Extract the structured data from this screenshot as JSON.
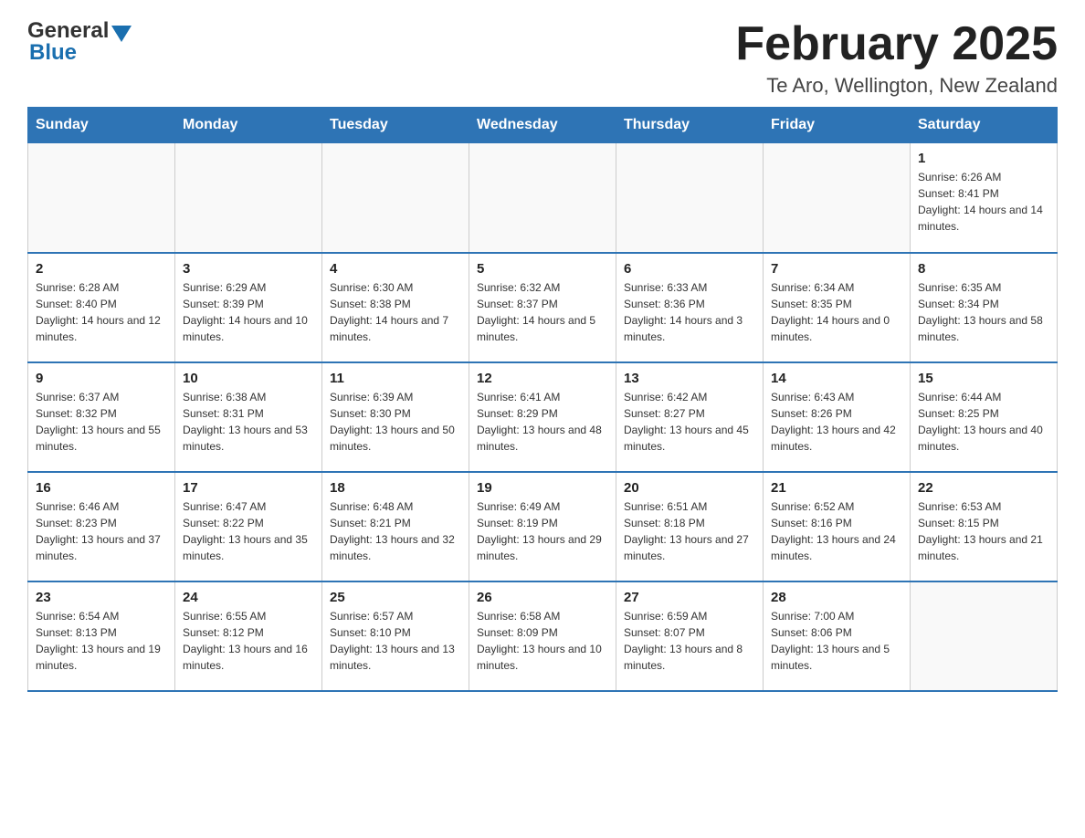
{
  "header": {
    "logo_general": "General",
    "logo_blue": "Blue",
    "month_title": "February 2025",
    "location": "Te Aro, Wellington, New Zealand"
  },
  "days_of_week": [
    "Sunday",
    "Monday",
    "Tuesday",
    "Wednesday",
    "Thursday",
    "Friday",
    "Saturday"
  ],
  "weeks": [
    [
      {
        "day": "",
        "info": ""
      },
      {
        "day": "",
        "info": ""
      },
      {
        "day": "",
        "info": ""
      },
      {
        "day": "",
        "info": ""
      },
      {
        "day": "",
        "info": ""
      },
      {
        "day": "",
        "info": ""
      },
      {
        "day": "1",
        "info": "Sunrise: 6:26 AM\nSunset: 8:41 PM\nDaylight: 14 hours and 14 minutes."
      }
    ],
    [
      {
        "day": "2",
        "info": "Sunrise: 6:28 AM\nSunset: 8:40 PM\nDaylight: 14 hours and 12 minutes."
      },
      {
        "day": "3",
        "info": "Sunrise: 6:29 AM\nSunset: 8:39 PM\nDaylight: 14 hours and 10 minutes."
      },
      {
        "day": "4",
        "info": "Sunrise: 6:30 AM\nSunset: 8:38 PM\nDaylight: 14 hours and 7 minutes."
      },
      {
        "day": "5",
        "info": "Sunrise: 6:32 AM\nSunset: 8:37 PM\nDaylight: 14 hours and 5 minutes."
      },
      {
        "day": "6",
        "info": "Sunrise: 6:33 AM\nSunset: 8:36 PM\nDaylight: 14 hours and 3 minutes."
      },
      {
        "day": "7",
        "info": "Sunrise: 6:34 AM\nSunset: 8:35 PM\nDaylight: 14 hours and 0 minutes."
      },
      {
        "day": "8",
        "info": "Sunrise: 6:35 AM\nSunset: 8:34 PM\nDaylight: 13 hours and 58 minutes."
      }
    ],
    [
      {
        "day": "9",
        "info": "Sunrise: 6:37 AM\nSunset: 8:32 PM\nDaylight: 13 hours and 55 minutes."
      },
      {
        "day": "10",
        "info": "Sunrise: 6:38 AM\nSunset: 8:31 PM\nDaylight: 13 hours and 53 minutes."
      },
      {
        "day": "11",
        "info": "Sunrise: 6:39 AM\nSunset: 8:30 PM\nDaylight: 13 hours and 50 minutes."
      },
      {
        "day": "12",
        "info": "Sunrise: 6:41 AM\nSunset: 8:29 PM\nDaylight: 13 hours and 48 minutes."
      },
      {
        "day": "13",
        "info": "Sunrise: 6:42 AM\nSunset: 8:27 PM\nDaylight: 13 hours and 45 minutes."
      },
      {
        "day": "14",
        "info": "Sunrise: 6:43 AM\nSunset: 8:26 PM\nDaylight: 13 hours and 42 minutes."
      },
      {
        "day": "15",
        "info": "Sunrise: 6:44 AM\nSunset: 8:25 PM\nDaylight: 13 hours and 40 minutes."
      }
    ],
    [
      {
        "day": "16",
        "info": "Sunrise: 6:46 AM\nSunset: 8:23 PM\nDaylight: 13 hours and 37 minutes."
      },
      {
        "day": "17",
        "info": "Sunrise: 6:47 AM\nSunset: 8:22 PM\nDaylight: 13 hours and 35 minutes."
      },
      {
        "day": "18",
        "info": "Sunrise: 6:48 AM\nSunset: 8:21 PM\nDaylight: 13 hours and 32 minutes."
      },
      {
        "day": "19",
        "info": "Sunrise: 6:49 AM\nSunset: 8:19 PM\nDaylight: 13 hours and 29 minutes."
      },
      {
        "day": "20",
        "info": "Sunrise: 6:51 AM\nSunset: 8:18 PM\nDaylight: 13 hours and 27 minutes."
      },
      {
        "day": "21",
        "info": "Sunrise: 6:52 AM\nSunset: 8:16 PM\nDaylight: 13 hours and 24 minutes."
      },
      {
        "day": "22",
        "info": "Sunrise: 6:53 AM\nSunset: 8:15 PM\nDaylight: 13 hours and 21 minutes."
      }
    ],
    [
      {
        "day": "23",
        "info": "Sunrise: 6:54 AM\nSunset: 8:13 PM\nDaylight: 13 hours and 19 minutes."
      },
      {
        "day": "24",
        "info": "Sunrise: 6:55 AM\nSunset: 8:12 PM\nDaylight: 13 hours and 16 minutes."
      },
      {
        "day": "25",
        "info": "Sunrise: 6:57 AM\nSunset: 8:10 PM\nDaylight: 13 hours and 13 minutes."
      },
      {
        "day": "26",
        "info": "Sunrise: 6:58 AM\nSunset: 8:09 PM\nDaylight: 13 hours and 10 minutes."
      },
      {
        "day": "27",
        "info": "Sunrise: 6:59 AM\nSunset: 8:07 PM\nDaylight: 13 hours and 8 minutes."
      },
      {
        "day": "28",
        "info": "Sunrise: 7:00 AM\nSunset: 8:06 PM\nDaylight: 13 hours and 5 minutes."
      },
      {
        "day": "",
        "info": ""
      }
    ]
  ]
}
